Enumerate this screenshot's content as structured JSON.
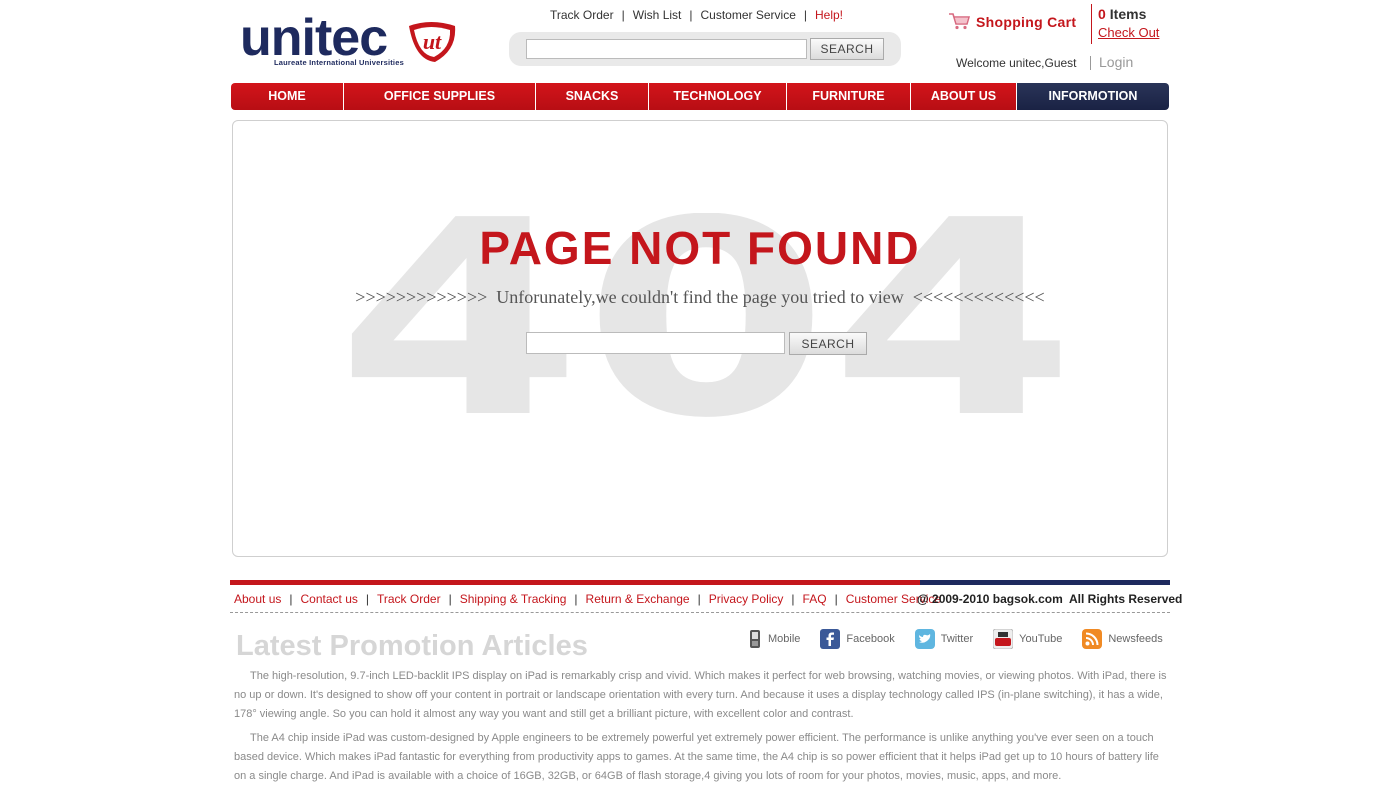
{
  "brand": {
    "logo_text": "unitec",
    "badge_text": "ut",
    "tagline": "Laureate International Universities",
    "colors": {
      "primary_red": "#c4161c",
      "navy": "#1e2a5e"
    }
  },
  "top_links": {
    "track_order": "Track Order",
    "wish_list": "Wish List",
    "customer_service": "Customer Service",
    "help": "Help!",
    "separator": "|"
  },
  "header_search": {
    "placeholder": "",
    "button": "SEARCH"
  },
  "cart": {
    "label": "Shopping Cart",
    "icon": "shopping-cart-icon",
    "count": "0",
    "items_label": "Items",
    "checkout": "Check Out"
  },
  "user": {
    "welcome": "Welcome unitec,Guest",
    "login": "Login"
  },
  "nav": [
    {
      "label": "HOME"
    },
    {
      "label": "OFFICE SUPPLIES"
    },
    {
      "label": "SNACKS"
    },
    {
      "label": "TECHNOLOGY"
    },
    {
      "label": "FURNITURE"
    },
    {
      "label": "ABOUT US"
    },
    {
      "label": "INFORMOTION"
    }
  ],
  "main": {
    "background_text": "404",
    "title": "PAGE NOT FOUND",
    "subtitle": ">>>>>>>>>>>>>  Unforunately,we couldn't find the page you tried to view  <<<<<<<<<<<<<",
    "search_button": "SEARCH"
  },
  "footer": {
    "links": [
      "About us",
      "Contact us",
      "Track Order",
      "Shipping & Tracking",
      "Return & Exchange",
      "Privacy Policy",
      "FAQ",
      "Customer Service"
    ],
    "copyright": "@ 2009-2010 bagsok.com  All Rights Reserved"
  },
  "promo": {
    "title": "Latest Promotion Articles",
    "social": [
      {
        "label": "Mobile",
        "icon": "mobile-icon"
      },
      {
        "label": "Facebook",
        "icon": "facebook-icon"
      },
      {
        "label": "Twitter",
        "icon": "twitter-icon"
      },
      {
        "label": "YouTube",
        "icon": "youtube-icon"
      },
      {
        "label": "Newsfeeds",
        "icon": "rss-icon"
      }
    ],
    "paragraphs": [
      "The high-resolution, 9.7-inch LED-backlit IPS display on iPad is remarkably crisp and vivid. Which makes it perfect for web browsing, watching movies, or viewing photos. With iPad, there is no up or down. It's designed to show off your content in portrait or landscape orientation with every turn. And because it uses a display technology called IPS (in-plane switching), it has a wide, 178° viewing angle. So you can hold it almost any way you want and still get a brilliant picture, with excellent color and contrast.",
      "The A4 chip inside iPad was custom-designed by Apple engineers to be extremely powerful yet extremely power efficient. The performance is unlike anything you've ever seen on a touch based device. Which makes iPad fantastic for everything from productivity apps to games. At the same time, the A4 chip is so power efficient that it helps iPad get up to 10 hours of battery life on a single charge. And iPad is available with a choice of 16GB, 32GB, or 64GB of flash storage,4 giving you lots of room for your photos, movies, music, apps, and more."
    ]
  }
}
